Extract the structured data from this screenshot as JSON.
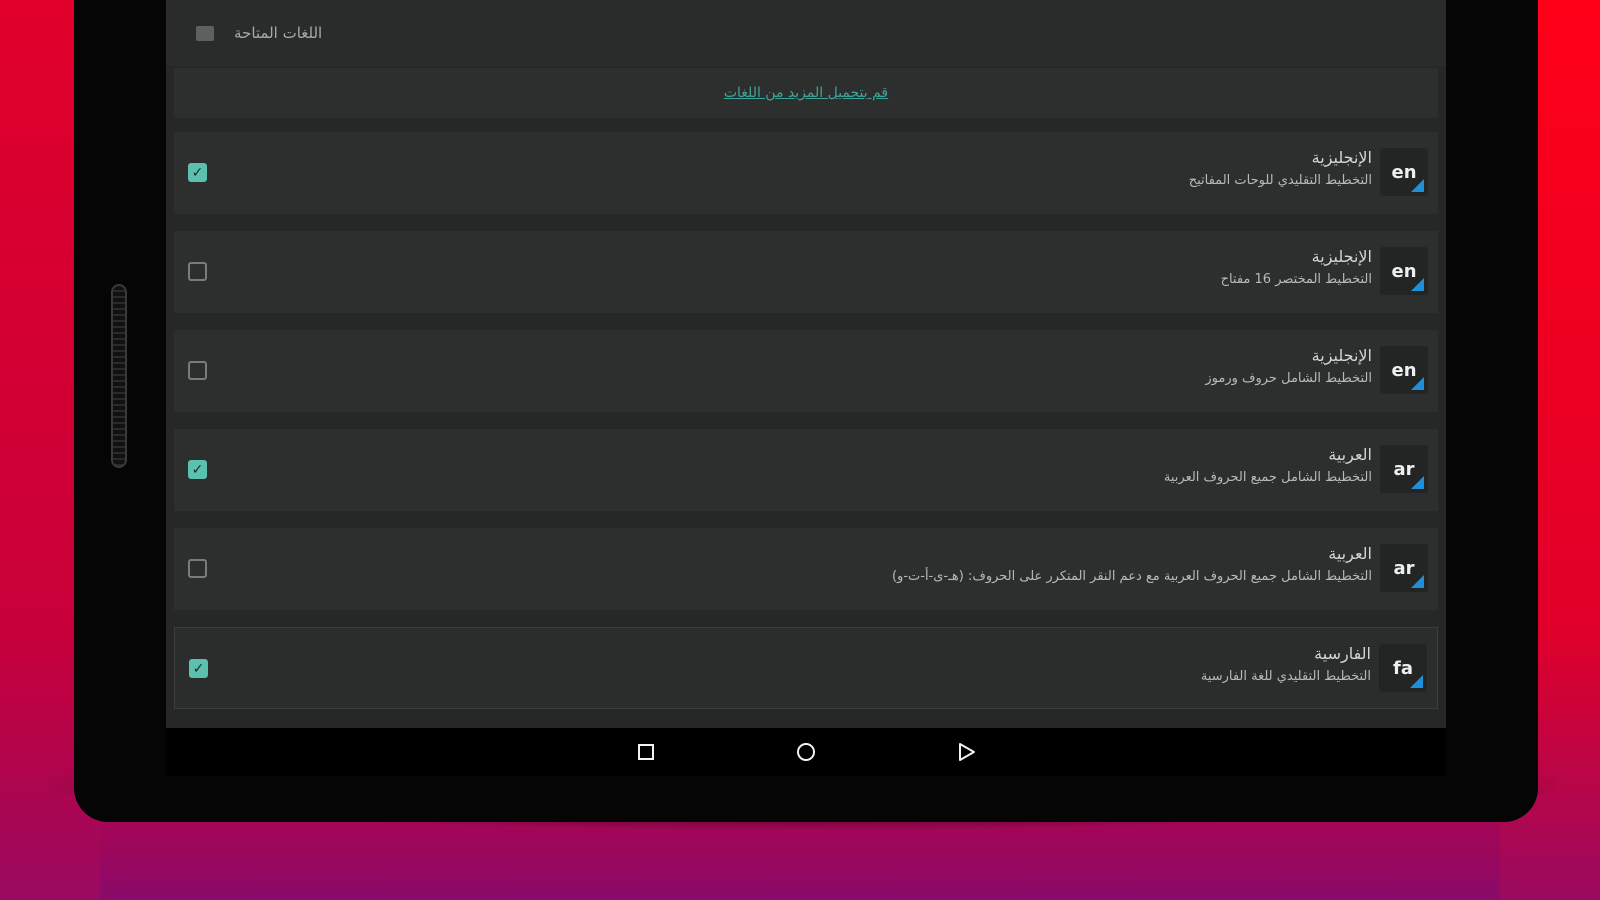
{
  "app": {
    "title": "اللغات المتاحة",
    "download_link": "قم بتحميل المزيد من اللغات"
  },
  "languages": [
    {
      "code": "en",
      "name": "الإنجليزية",
      "layout": "التخطيط التقليدي للوحات المفاتيح",
      "checked": true
    },
    {
      "code": "en",
      "name": "الإنجليزية",
      "layout": "التخطيط المختصر 16 مفتاح",
      "checked": false
    },
    {
      "code": "en",
      "name": "الإنجليزية",
      "layout": "التخطيط الشامل حروف ورموز",
      "checked": false
    },
    {
      "code": "ar",
      "name": "العربية",
      "layout": "التخطيط الشامل جميع الحروف العربية",
      "checked": true
    },
    {
      "code": "ar",
      "name": "العربية",
      "layout": "التخطيط الشامل جميع الحروف العربية مع دعم النقر المتكرر على الحروف: (هـ-ى-أ-ت-و)",
      "checked": false
    },
    {
      "code": "fa",
      "name": "الفارسية",
      "layout": "التخطيط التقليدي للغة الفارسية",
      "checked": true
    }
  ],
  "navbar": {
    "buttons": [
      "recents-icon",
      "home-icon",
      "back-icon"
    ]
  },
  "colors": {
    "accent": "#5cc0ae",
    "link": "#3ea69a",
    "badge_corner": "#1e8fd8",
    "background": "#e40028"
  }
}
